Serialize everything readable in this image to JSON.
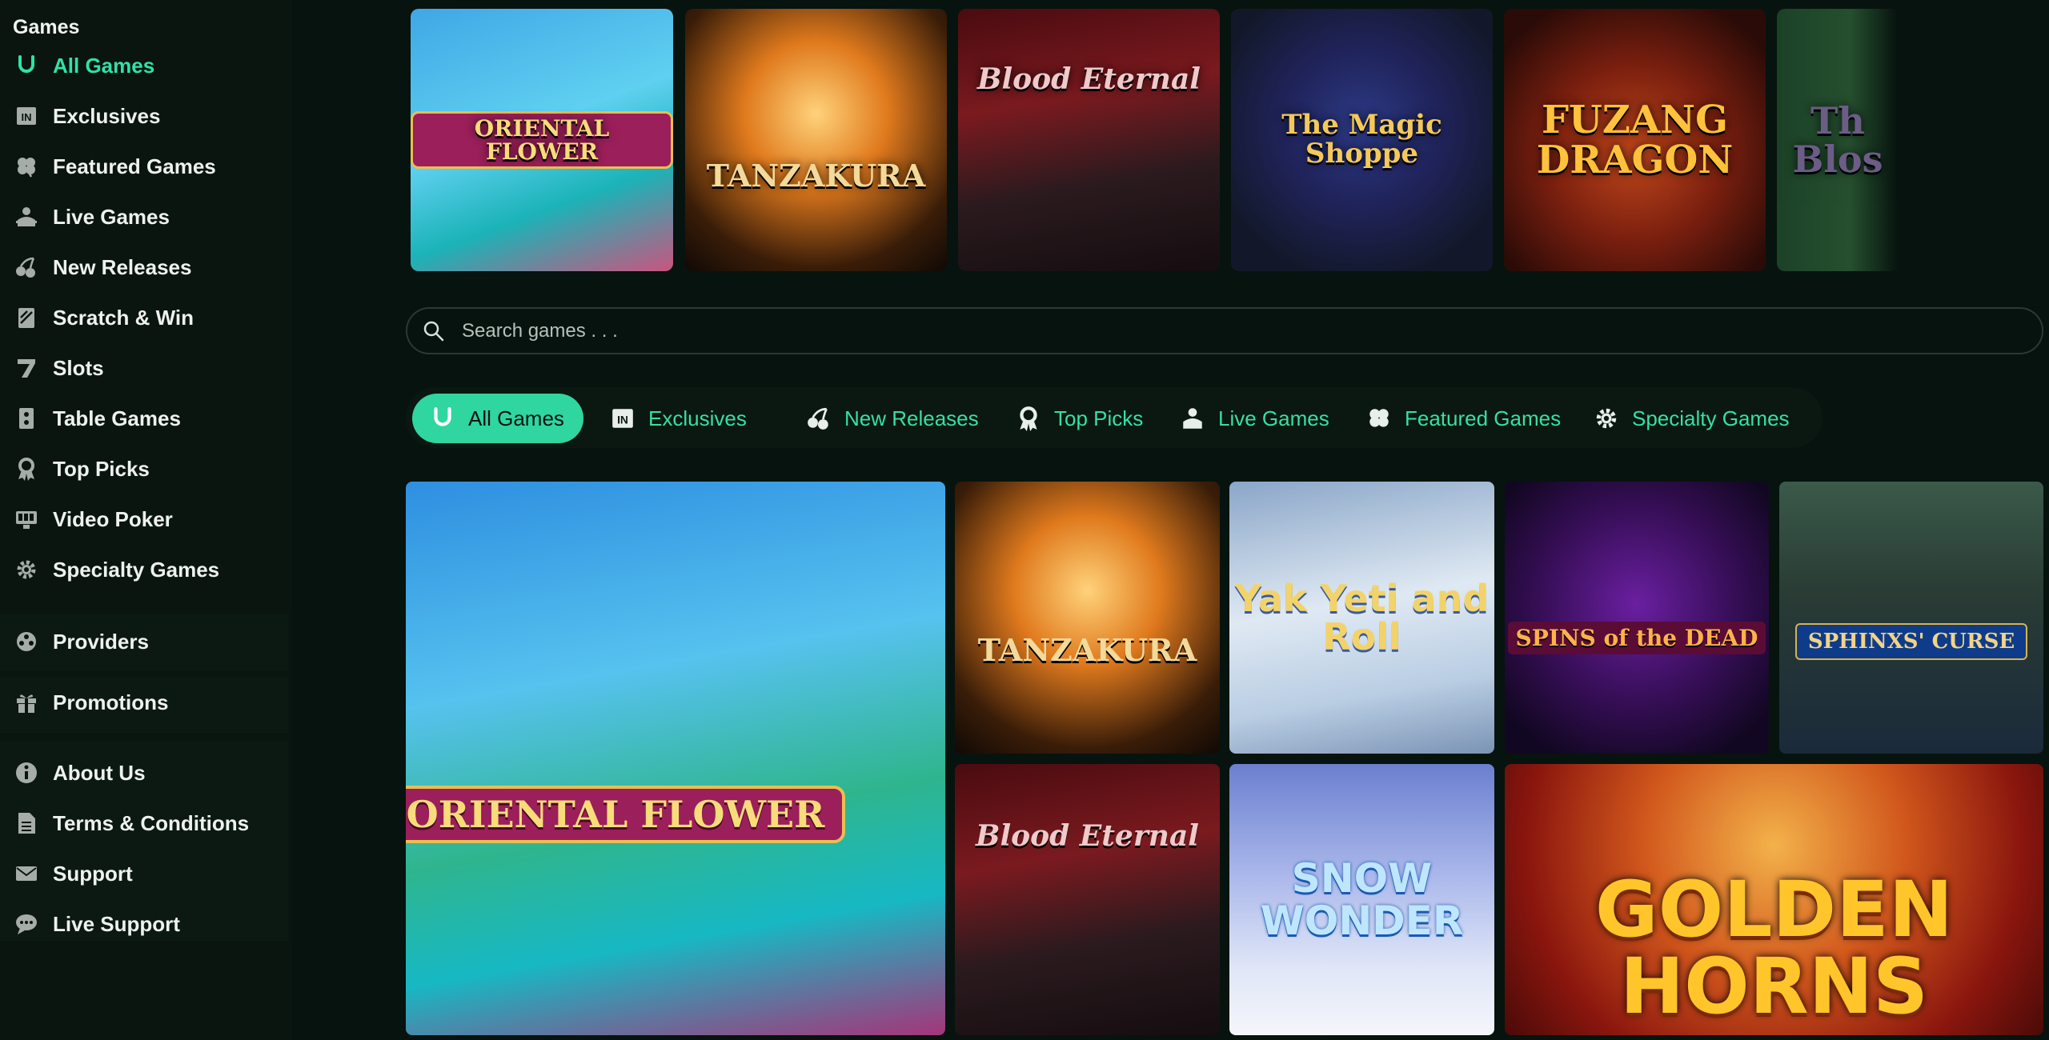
{
  "sidebar": {
    "heading": "Games",
    "items": [
      {
        "label": "All Games",
        "icon": "horseshoe-icon"
      },
      {
        "label": "Exclusives",
        "icon": "exclusive-icon"
      },
      {
        "label": "Featured Games",
        "icon": "clover-icon"
      },
      {
        "label": "Live Games",
        "icon": "live-dealer-icon"
      },
      {
        "label": "New Releases",
        "icon": "cherries-icon"
      },
      {
        "label": "Scratch & Win",
        "icon": "scratch-card-icon"
      },
      {
        "label": "Slots",
        "icon": "seven-icon"
      },
      {
        "label": "Table Games",
        "icon": "table-games-icon"
      },
      {
        "label": "Top Picks",
        "icon": "award-icon"
      },
      {
        "label": "Video Poker",
        "icon": "video-poker-icon"
      },
      {
        "label": "Specialty Games",
        "icon": "gear-icon"
      }
    ],
    "providers": "Providers",
    "promotions": "Promotions",
    "info": [
      "About Us",
      "Terms & Conditions",
      "Support",
      "Live Support"
    ]
  },
  "top_strip": [
    {
      "title": "ORIENTAL FLOWER"
    },
    {
      "title": "TANZAKURA"
    },
    {
      "title": "Blood Eternal"
    },
    {
      "title": "The Magic Shoppe"
    },
    {
      "title": "FUZANG DRAGON"
    },
    {
      "title": "Th Blos"
    }
  ],
  "search": {
    "placeholder": "Search games . . ."
  },
  "tabs": [
    {
      "label": "All Games",
      "icon": "horseshoe-icon"
    },
    {
      "label": "Exclusives",
      "icon": "exclusive-icon"
    },
    {
      "label": "New Releases",
      "icon": "cherries-icon"
    },
    {
      "label": "Top Picks",
      "icon": "award-icon"
    },
    {
      "label": "Live Games",
      "icon": "live-dealer-icon"
    },
    {
      "label": "Featured Games",
      "icon": "clover-icon"
    },
    {
      "label": "Specialty Games",
      "icon": "gear-icon"
    }
  ],
  "grid": [
    {
      "title": "ORIENTAL FLOWER"
    },
    {
      "title": "TANZAKURA"
    },
    {
      "title": "Yak Yeti and Roll"
    },
    {
      "title": "SPINS of the DEAD"
    },
    {
      "title": "SPHINXS' CURSE"
    },
    {
      "title": "Blood Eternal"
    },
    {
      "title": "SNOW WONDER"
    },
    {
      "title": "GOLDEN HORNS"
    }
  ],
  "colors": {
    "accent": "#2fe2a8",
    "background": "#07130e",
    "sidebar": "#0a1510"
  }
}
